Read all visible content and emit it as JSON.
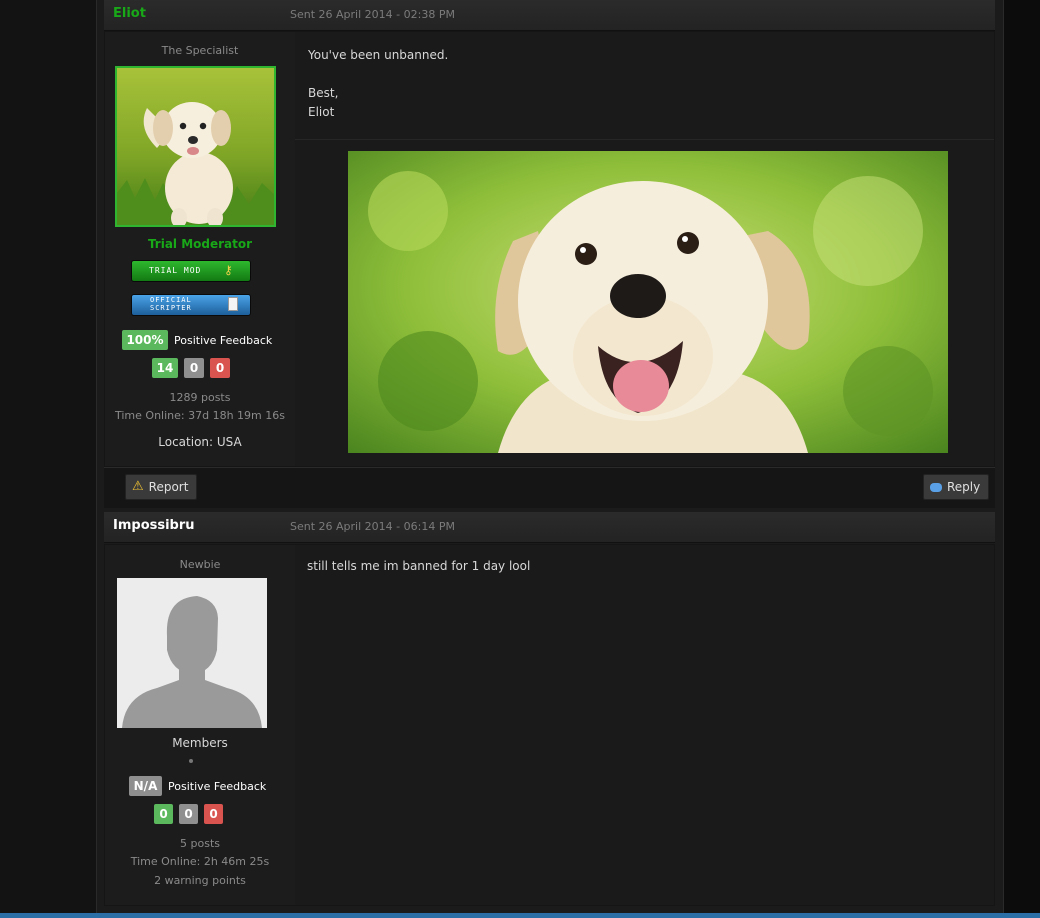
{
  "colors": {
    "green_name": "#18a818",
    "feedback_green": "#5cb85c",
    "feedback_grey": "#8f8f8f",
    "feedback_red": "#d9534f"
  },
  "posts": [
    {
      "author": "Eliot",
      "date": "Sent 26 April 2014 - 02:38 PM",
      "title": "The Specialist",
      "group": "Trial Moderator",
      "badges": [
        "TRIAL MOD",
        "OFFICIAL SCRIPTER"
      ],
      "feedback_pct": "100%",
      "feedback_label": "Positive Feedback",
      "fb_pos": "14",
      "fb_neu": "0",
      "fb_neg": "0",
      "posts": "1289 posts",
      "time_online": "Time Online: 37d 18h 19m 16s",
      "location": "Location: USA",
      "message": [
        "You've been unbanned.",
        "Best,",
        "Eliot"
      ],
      "report_label": "Report",
      "reply_label": "Reply"
    },
    {
      "author": "Impossibru",
      "date": "Sent 26 April 2014 - 06:14 PM",
      "title": "Newbie",
      "group": "Members",
      "feedback_pct": "N/A",
      "feedback_label": "Positive Feedback",
      "fb_pos": "0",
      "fb_neu": "0",
      "fb_neg": "0",
      "posts": "5 posts",
      "time_online": "Time Online: 2h 46m 25s",
      "warnings": "2 warning points",
      "message": [
        "still tells me im banned for 1 day lool"
      ]
    }
  ]
}
